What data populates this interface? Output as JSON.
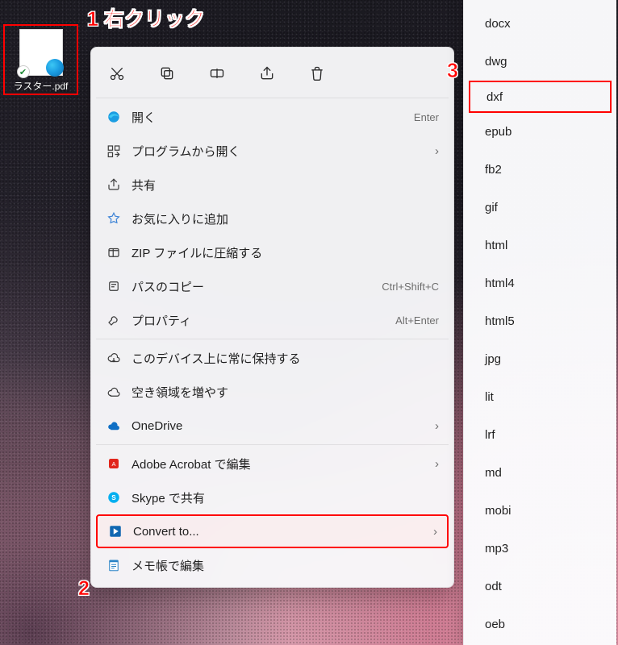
{
  "annotations": {
    "a1": "1 右クリック",
    "a2": "2",
    "a3": "3"
  },
  "desktop": {
    "file_name": "ラスター.pdf"
  },
  "context_menu": {
    "open": {
      "label": "開く",
      "accel": "Enter"
    },
    "open_with": {
      "label": "プログラムから開く"
    },
    "share": {
      "label": "共有"
    },
    "favorite": {
      "label": "お気に入りに追加"
    },
    "zip": {
      "label": "ZIP ファイルに圧縮する"
    },
    "copy_path": {
      "label": "パスのコピー",
      "accel": "Ctrl+Shift+C"
    },
    "properties": {
      "label": "プロパティ",
      "accel": "Alt+Enter"
    },
    "keep_on_device": {
      "label": "このデバイス上に常に保持する"
    },
    "free_space": {
      "label": "空き領域を増やす"
    },
    "onedrive": {
      "label": "OneDrive"
    },
    "acrobat": {
      "label": "Adobe Acrobat で編集"
    },
    "skype": {
      "label": "Skype で共有"
    },
    "convert": {
      "label": "Convert to..."
    },
    "notepad": {
      "label": "メモ帳で編集"
    }
  },
  "submenu": {
    "items": [
      "docx",
      "dwg",
      "dxf",
      "epub",
      "fb2",
      "gif",
      "html",
      "html4",
      "html5",
      "jpg",
      "lit",
      "lrf",
      "md",
      "mobi",
      "mp3",
      "odt",
      "oeb"
    ],
    "highlighted_index": 2
  }
}
